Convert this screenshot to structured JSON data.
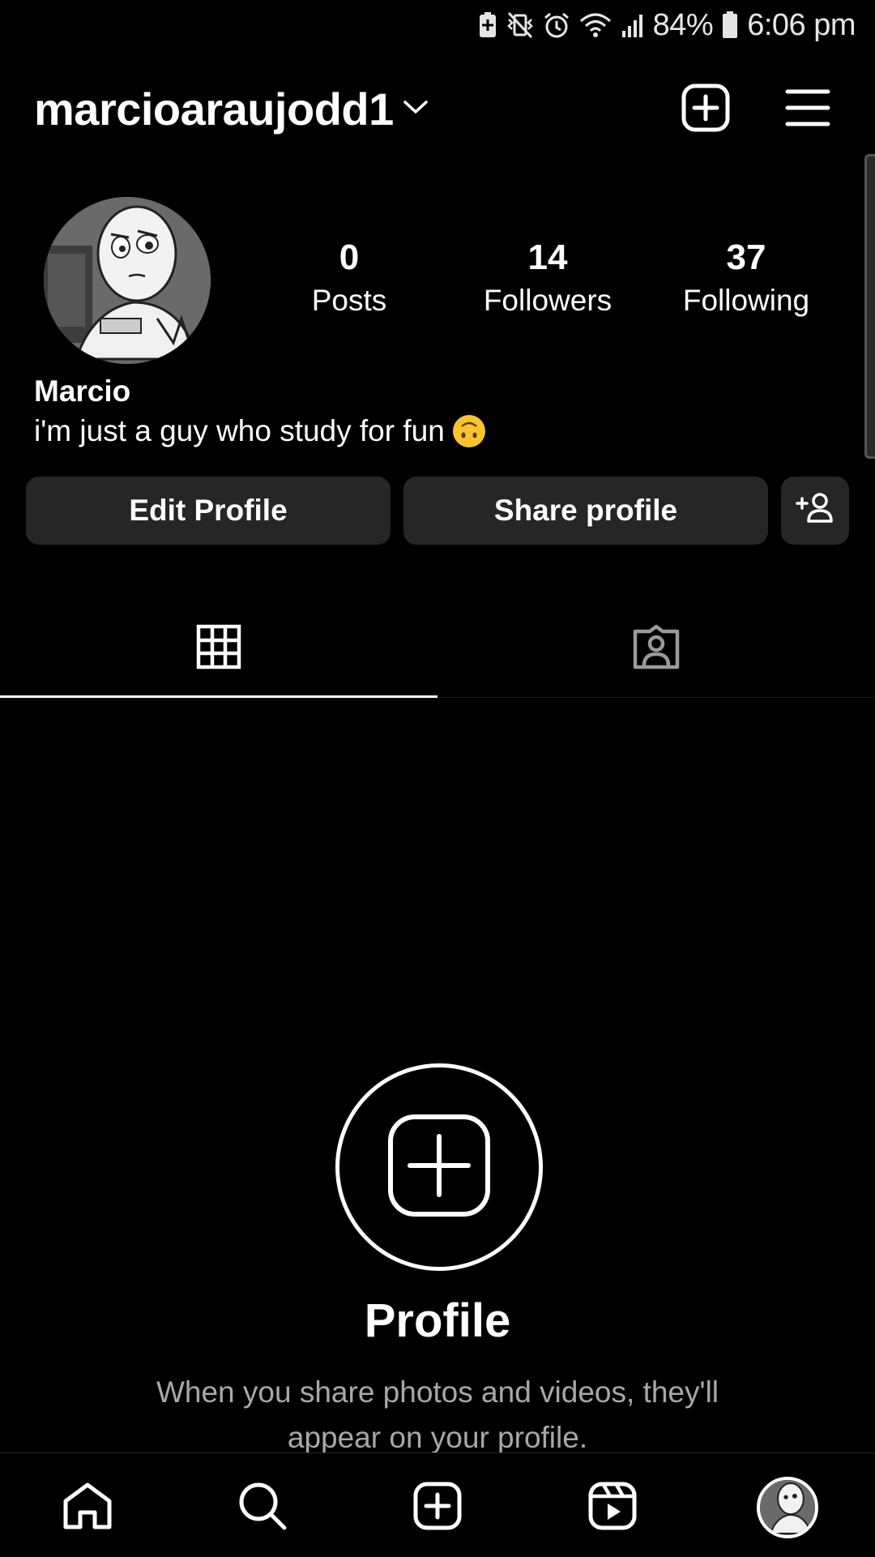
{
  "status_bar": {
    "battery": "84%",
    "time": "6:06 pm",
    "icons": [
      "battery-saver-icon",
      "vibrate-mute-icon",
      "alarm-icon",
      "wifi-icon",
      "signal-icon",
      "battery-icon"
    ]
  },
  "header": {
    "username": "marcioaraujodd1",
    "icons": [
      "chevron-down-icon",
      "create-post-icon",
      "menu-icon"
    ]
  },
  "profile": {
    "avatar_icon": "avatar",
    "stats": [
      {
        "value": "0",
        "label": "Posts"
      },
      {
        "value": "14",
        "label": "Followers"
      },
      {
        "value": "37",
        "label": "Following"
      }
    ],
    "display_name": "Marcio",
    "bio": "i'm just a guy who study for fun",
    "bio_emoji": "upside-down-face-emoji"
  },
  "actions": {
    "edit_profile": "Edit Profile",
    "share_profile": "Share profile",
    "discover_people_icon": "add-person-icon"
  },
  "tabs": {
    "items": [
      {
        "icon": "grid-icon",
        "active": true
      },
      {
        "icon": "tagged-icon",
        "active": false
      }
    ]
  },
  "empty_state": {
    "icon": "add-post-icon",
    "title": "Profile",
    "description": "When you share photos and videos, they'll appear on your profile."
  },
  "bottom_nav": {
    "items": [
      "home-icon",
      "search-icon",
      "create-icon",
      "reels-icon",
      "profile-avatar"
    ]
  },
  "colors": {
    "background": "#000000",
    "button_bg": "#262626",
    "secondary_text": "#a8a8a8",
    "emoji": "#f7c32e"
  }
}
